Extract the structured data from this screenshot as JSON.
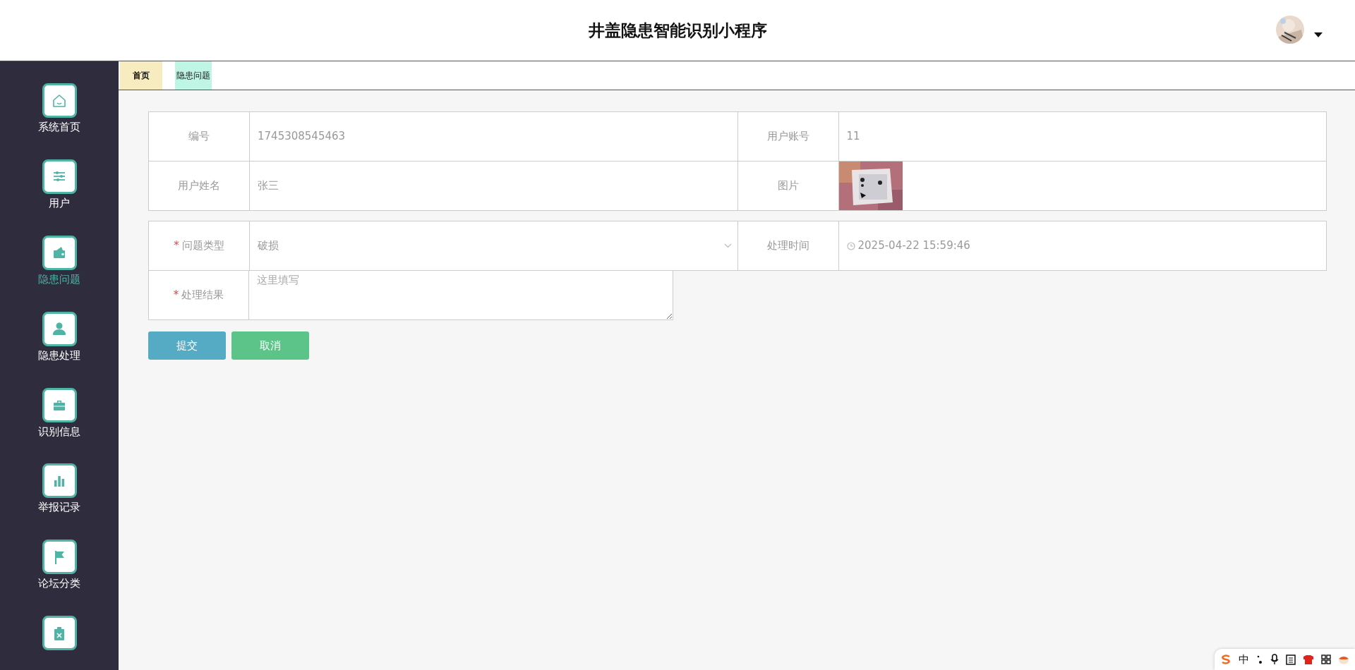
{
  "header": {
    "title": "井盖隐患智能识别小程序"
  },
  "sidebar": {
    "items": [
      {
        "label": "系统首页",
        "selected": false
      },
      {
        "label": "用户",
        "selected": false
      },
      {
        "label": "隐患问题",
        "selected": true
      },
      {
        "label": "隐患处理",
        "selected": false
      },
      {
        "label": "识别信息",
        "selected": false
      },
      {
        "label": "举报记录",
        "selected": false
      },
      {
        "label": "论坛分类",
        "selected": false
      },
      {
        "selected": false
      }
    ]
  },
  "tabs": [
    {
      "label": "首页",
      "selected": false,
      "color": "#f7ebc0"
    },
    {
      "label": "隐患问题",
      "selected": true,
      "color": "#bff5e4"
    }
  ],
  "form": {
    "info_rows": [
      [
        {
          "label": "编号",
          "value": "1745308545463"
        },
        {
          "label": "用户账号",
          "value": "11"
        }
      ],
      [
        {
          "label": "用户姓名",
          "value": "张三"
        },
        {
          "label": "图片",
          "kind": "picture"
        }
      ]
    ],
    "problem_type": {
      "required_mark": "*",
      "label": "问题类型",
      "value": "破损"
    },
    "handle_time": {
      "label": "处理时间",
      "value": "2025-04-22 15:59:46"
    },
    "result": {
      "required_mark": "*",
      "label": "处理结果",
      "placeholder": "这里填写"
    },
    "buttons": [
      {
        "label": "提交",
        "kind": "submit"
      },
      {
        "label": "取消",
        "kind": "cancel"
      }
    ]
  },
  "ime_toolbar": {
    "mode": "中"
  }
}
